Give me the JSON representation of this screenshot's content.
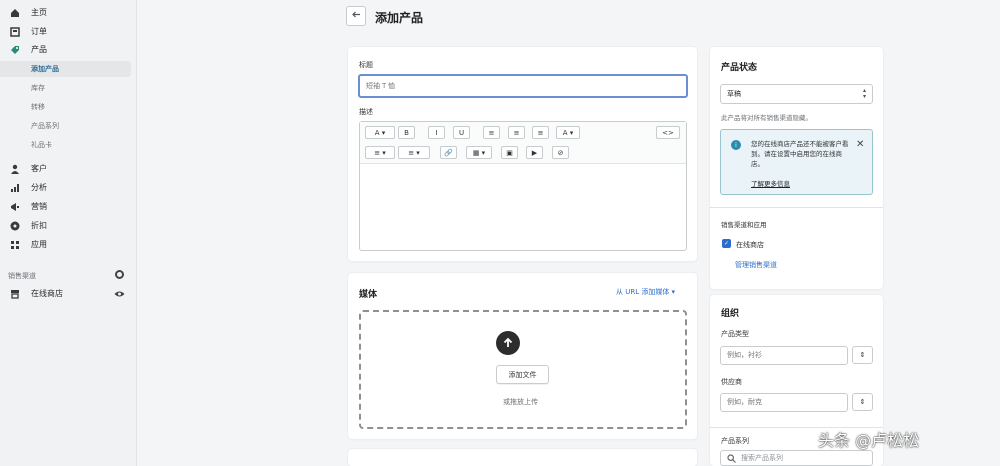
{
  "sidebar": {
    "items": [
      {
        "label": "主页",
        "icon": "home-icon"
      },
      {
        "label": "订单",
        "icon": "orders-icon"
      },
      {
        "label": "产品",
        "icon": "tag-icon"
      }
    ],
    "subitems": [
      {
        "label": "添加产品"
      },
      {
        "label": "库存"
      },
      {
        "label": "转移"
      },
      {
        "label": "产品系列"
      },
      {
        "label": "礼品卡"
      }
    ],
    "items2": [
      {
        "label": "客户",
        "icon": "person-icon"
      },
      {
        "label": "分析",
        "icon": "analytics-icon"
      },
      {
        "label": "营销",
        "icon": "megaphone-icon"
      },
      {
        "label": "折扣",
        "icon": "discount-icon"
      },
      {
        "label": "应用",
        "icon": "apps-icon"
      }
    ],
    "channels_label": "销售渠道",
    "channel": {
      "label": "在线商店",
      "icon": "store-icon"
    }
  },
  "header": {
    "title": "添加产品"
  },
  "main": {
    "title_label": "标题",
    "title_placeholder": "短袖 T 恤",
    "description_label": "描述",
    "toolbar_row1": [
      "A ▾",
      "B",
      "I",
      "U",
      "≡",
      "≡",
      "≡",
      "A ▾"
    ],
    "toolbar_html": "<>",
    "toolbar_row2": [
      "≡ ▾",
      "≡ ▾",
      "🔗",
      "▦ ▾",
      "▣",
      "▶",
      "⊘"
    ],
    "media_title": "媒体",
    "media_link": "从 URL 添加媒体 ▾",
    "upload_button": "添加文件",
    "drop_hint": "或拖放上传"
  },
  "right": {
    "status_title": "产品状态",
    "status_value": "草稿",
    "status_help": "此产品将对所有销售渠道隐藏。",
    "banner_text": "您的在线商店产品还不能被客户看到。请在设置中启用您的在线商店。",
    "banner_link": "了解更多信息",
    "channels_title": "销售渠道和应用",
    "channel_checkbox_label": "在线商店",
    "manage_link": "管理销售渠道",
    "org_title": "组织",
    "type_label": "产品类型",
    "type_placeholder": "例如，衬衫",
    "vendor_label": "供应商",
    "vendor_placeholder": "例如，耐克",
    "collections_label": "产品系列",
    "collections_placeholder": "搜索产品系列"
  },
  "watermark": "头条 @卢松松",
  "colors": {
    "accent": "#2c6ecb",
    "focus": "#6c8fd1",
    "banner_bg": "#eaf4f8",
    "banner_border": "#98c6cd"
  }
}
